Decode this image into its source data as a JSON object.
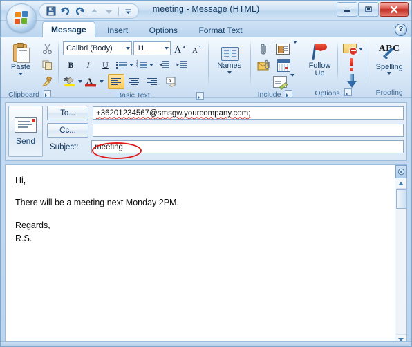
{
  "window": {
    "title": "meeting - Message (HTML)",
    "minimize_label": "Minimize",
    "restore_label": "Restore",
    "close_label": "Close"
  },
  "office_button": {
    "label": "Office Button"
  },
  "quick_access": {
    "items": [
      {
        "name": "save",
        "label": "Save",
        "icon": "save-icon"
      },
      {
        "name": "undo",
        "label": "Undo",
        "icon": "undo-icon"
      },
      {
        "name": "redo",
        "label": "Redo",
        "icon": "redo-icon"
      },
      {
        "name": "previous",
        "label": "Previous Item",
        "icon": "up-arrow-icon"
      },
      {
        "name": "next",
        "label": "Next Item",
        "icon": "down-arrow-icon"
      },
      {
        "name": "customize",
        "label": "Customize Quick Access Toolbar",
        "icon": "chevron-down-icon"
      }
    ]
  },
  "tabs": [
    {
      "label": "Message",
      "active": true
    },
    {
      "label": "Insert",
      "active": false
    },
    {
      "label": "Options",
      "active": false
    },
    {
      "label": "Format Text",
      "active": false
    }
  ],
  "help": {
    "label": "?"
  },
  "ribbon": {
    "groups": [
      {
        "name": "clipboard",
        "label": "Clipboard",
        "launcher": true
      },
      {
        "name": "basic-text",
        "label": "Basic Text",
        "launcher": true
      },
      {
        "name": "names",
        "label": "Names",
        "launcher": false
      },
      {
        "name": "include",
        "label": "Include",
        "launcher": true
      },
      {
        "name": "options",
        "label": "Options",
        "launcher": true
      },
      {
        "name": "proofing",
        "label": "Proofing",
        "launcher": false
      }
    ],
    "clipboard": {
      "paste_label": "Paste",
      "cut_label": "Cut",
      "copy_label": "Copy",
      "format_painter_label": "Format Painter"
    },
    "basic_text": {
      "font_name": "Calibri (Body)",
      "font_size": "11",
      "grow_font_label": "Grow Font",
      "shrink_font_label": "Shrink Font",
      "bold_label": "B",
      "italic_label": "I",
      "underline_label": "U",
      "bullets_label": "Bullets",
      "numbering_label": "Numbering",
      "decrease_indent_label": "Decrease Indent",
      "increase_indent_label": "Increase Indent",
      "highlight_label": "Text Highlight Color",
      "font_color_label": "Font Color",
      "align_left_label": "Align Text Left",
      "align_center_label": "Center",
      "align_right_label": "Align Text Right",
      "clear_formatting_label": "Clear Formatting"
    },
    "names": {
      "label": "Names",
      "address_book_label": "Address Book"
    },
    "include": {
      "attach_file_label": "Attach File",
      "business_card_label": "Business Card",
      "attach_item_label": "Attach Item",
      "calendar_label": "Calendar",
      "signature_label": "Signature"
    },
    "options": {
      "follow_up_label_line1": "Follow",
      "follow_up_label_line2": "Up",
      "permission_label": "Permission",
      "high_importance_label": "High Importance",
      "low_importance_label": "Low Importance"
    },
    "proofing": {
      "spelling_label": "Spelling",
      "abc_label": "ABC"
    }
  },
  "compose": {
    "send_label": "Send",
    "to_label": "To...",
    "cc_label": "Cc...",
    "subject_label": "Subject:",
    "to_value": "+36201234567@smsgw.yourcompany.com;",
    "cc_value": "",
    "subject_value": "meeting"
  },
  "body": {
    "lines": [
      "Hi,",
      "There will be a meeting next Monday 2PM.",
      "Regards,",
      "R.S."
    ]
  },
  "annotation": {
    "shape": "ellipse",
    "color": "#e01b1b",
    "target": "subject_value"
  },
  "colors": {
    "annotation_red": "#e01b1b",
    "title_text": "#123a63",
    "tab_text": "#16436f",
    "group_label": "#3d6a97",
    "close_button": "#bf2d22",
    "spellcheck_underline": "#d8352a"
  }
}
